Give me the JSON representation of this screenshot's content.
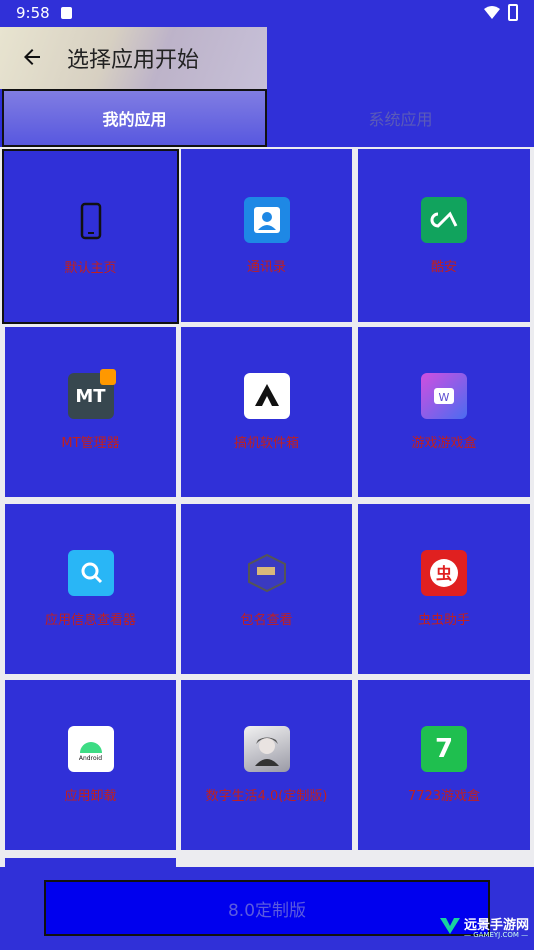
{
  "status_bar": {
    "time": "9:58"
  },
  "header": {
    "title": "选择应用开始"
  },
  "tabs": [
    {
      "label": "我的应用"
    },
    {
      "label": "系统应用"
    }
  ],
  "apps": [
    {
      "label": "默认主页",
      "icon": "phone-icon"
    },
    {
      "label": "通讯录",
      "icon": "contacts-icon"
    },
    {
      "label": "酷安",
      "icon": "coolapk-icon"
    },
    {
      "label": "MT管理器",
      "icon": "mt-manager-icon"
    },
    {
      "label": "搞机软件箱",
      "icon": "toolbox-icon"
    },
    {
      "label": "游戏游戏盒",
      "icon": "game-box-icon"
    },
    {
      "label": "应用信息查看器",
      "icon": "app-info-icon"
    },
    {
      "label": "包名查看",
      "icon": "package-icon"
    },
    {
      "label": "虫虫助手",
      "icon": "chongchong-icon"
    },
    {
      "label": "应用卸载",
      "icon": "android-icon"
    },
    {
      "label": "数字生活4.0(定制版)",
      "icon": "avatar-icon"
    },
    {
      "label": "7723游戏盒",
      "icon": "seven-icon"
    }
  ],
  "bottom": {
    "button_label": "8.0定制版"
  },
  "watermark": {
    "title": "远景手游网",
    "subtitle": "— GAMEYJ.COM —"
  },
  "colors": {
    "background": "#3030d8",
    "label": "#c02020",
    "grid_gap": "#ececf0"
  }
}
